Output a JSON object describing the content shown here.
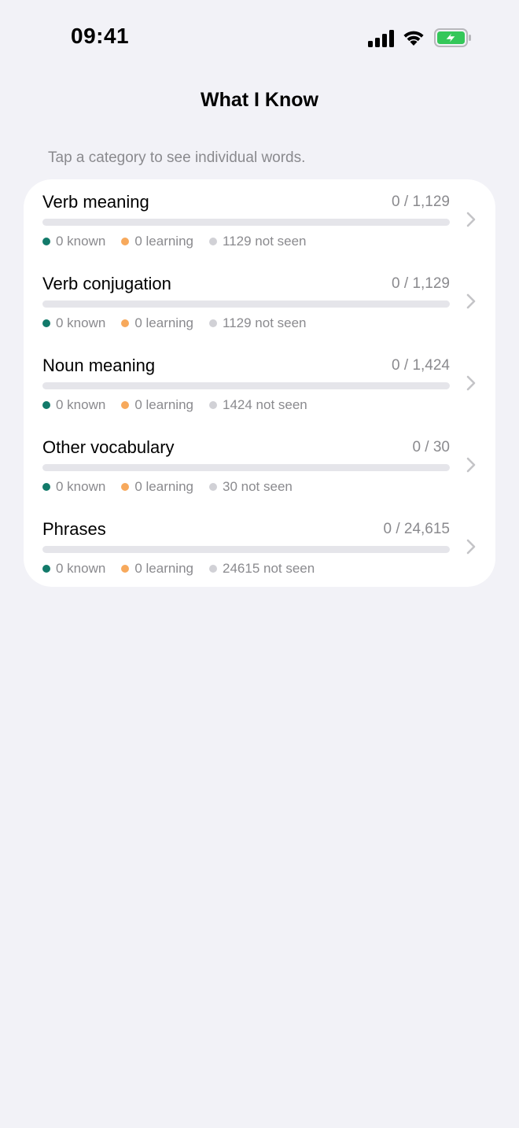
{
  "status_bar": {
    "time": "09:41",
    "icons": [
      "signal-icon",
      "wifi-icon",
      "battery-charging-icon"
    ]
  },
  "header": {
    "title": "What I Know"
  },
  "caption": "Tap a category to see individual words.",
  "colors": {
    "known": "#127a6a",
    "learning": "#f7a95c",
    "not_seen": "#d1d1d6",
    "battery": "#34c759"
  },
  "categories": [
    {
      "title": "Verb meaning",
      "count": "0 / 1,129",
      "progress": 0,
      "known": "0 known",
      "learning": "0 learning",
      "not_seen": "1129 not seen"
    },
    {
      "title": "Verb conjugation",
      "count": "0 / 1,129",
      "progress": 0,
      "known": "0 known",
      "learning": "0 learning",
      "not_seen": "1129 not seen"
    },
    {
      "title": "Noun meaning",
      "count": "0 / 1,424",
      "progress": 0,
      "known": "0 known",
      "learning": "0 learning",
      "not_seen": "1424 not seen"
    },
    {
      "title": "Other vocabulary",
      "count": "0 / 30",
      "progress": 0,
      "known": "0 known",
      "learning": "0 learning",
      "not_seen": "30 not seen"
    },
    {
      "title": "Phrases",
      "count": "0 / 24,615",
      "progress": 0,
      "known": "0 known",
      "learning": "0 learning",
      "not_seen": "24615 not seen"
    }
  ]
}
